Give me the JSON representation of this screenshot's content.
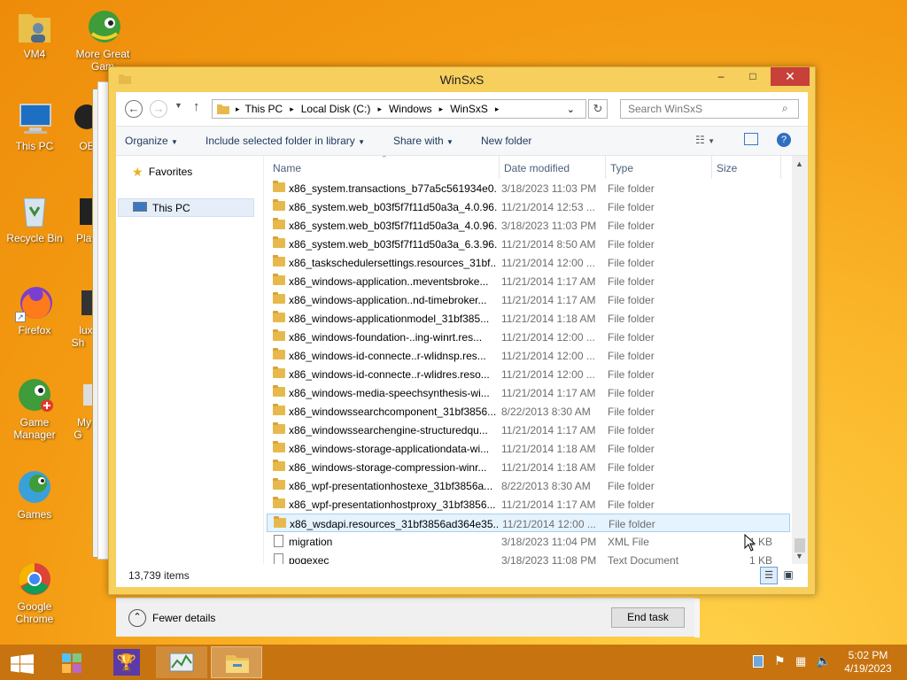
{
  "desktop": {
    "icons": [
      {
        "label": "VM4",
        "icon": "user-folder-icon"
      },
      {
        "label": "More Great Gam",
        "icon": "game-icon"
      },
      {
        "label": "This PC",
        "icon": "computer-icon"
      },
      {
        "label": "OB",
        "icon": "app-icon"
      },
      {
        "label": "Recycle Bin",
        "icon": "recycle-bin-icon"
      },
      {
        "label": "Play",
        "icon": "app-icon"
      },
      {
        "label": "Firefox",
        "icon": "firefox-icon"
      },
      {
        "label": "lux Sh",
        "icon": "app-icon"
      },
      {
        "label": "Game Manager",
        "icon": "game-manager-icon"
      },
      {
        "label": "My G",
        "icon": "app-icon"
      },
      {
        "label": "Games",
        "icon": "games-icon"
      },
      {
        "label": "Google Chrome",
        "icon": "chrome-icon"
      }
    ]
  },
  "window": {
    "title": "WinSxS",
    "controls": {
      "minimize": "–",
      "maximize": "□",
      "close": "✕"
    }
  },
  "address": {
    "path": [
      "This PC",
      "Local Disk (C:)",
      "Windows",
      "WinSxS"
    ],
    "search_placeholder": "Search WinSxS"
  },
  "toolbar": {
    "organize": "Organize",
    "include": "Include selected folder in library",
    "share": "Share with",
    "new_folder": "New folder"
  },
  "nav": {
    "favorites": "Favorites",
    "this_pc": "This PC"
  },
  "columns": {
    "name": "Name",
    "date": "Date modified",
    "type": "Type",
    "size": "Size"
  },
  "files": [
    {
      "name": "x86_system.transactions_b77a5c561934e0...",
      "date": "3/18/2023 11:03 PM",
      "type": "File folder",
      "size": "",
      "kind": "folder"
    },
    {
      "name": "x86_system.web_b03f5f7f11d50a3a_4.0.96...",
      "date": "11/21/2014 12:53 ...",
      "type": "File folder",
      "size": "",
      "kind": "folder"
    },
    {
      "name": "x86_system.web_b03f5f7f11d50a3a_4.0.96...",
      "date": "3/18/2023 11:03 PM",
      "type": "File folder",
      "size": "",
      "kind": "folder"
    },
    {
      "name": "x86_system.web_b03f5f7f11d50a3a_6.3.96...",
      "date": "11/21/2014 8:50 AM",
      "type": "File folder",
      "size": "",
      "kind": "folder"
    },
    {
      "name": "x86_taskschedulersettings.resources_31bf...",
      "date": "11/21/2014 12:00 ...",
      "type": "File folder",
      "size": "",
      "kind": "folder"
    },
    {
      "name": "x86_windows-application..meventsbroke...",
      "date": "11/21/2014 1:17 AM",
      "type": "File folder",
      "size": "",
      "kind": "folder"
    },
    {
      "name": "x86_windows-application..nd-timebroker...",
      "date": "11/21/2014 1:17 AM",
      "type": "File folder",
      "size": "",
      "kind": "folder"
    },
    {
      "name": "x86_windows-applicationmodel_31bf385...",
      "date": "11/21/2014 1:18 AM",
      "type": "File folder",
      "size": "",
      "kind": "folder"
    },
    {
      "name": "x86_windows-foundation-..ing-winrt.res...",
      "date": "11/21/2014 12:00 ...",
      "type": "File folder",
      "size": "",
      "kind": "folder"
    },
    {
      "name": "x86_windows-id-connecte..r-wlidnsp.res...",
      "date": "11/21/2014 12:00 ...",
      "type": "File folder",
      "size": "",
      "kind": "folder"
    },
    {
      "name": "x86_windows-id-connecte..r-wlidres.reso...",
      "date": "11/21/2014 12:00 ...",
      "type": "File folder",
      "size": "",
      "kind": "folder"
    },
    {
      "name": "x86_windows-media-speechsynthesis-wi...",
      "date": "11/21/2014 1:17 AM",
      "type": "File folder",
      "size": "",
      "kind": "folder"
    },
    {
      "name": "x86_windowssearchcomponent_31bf3856...",
      "date": "8/22/2013 8:30 AM",
      "type": "File folder",
      "size": "",
      "kind": "folder"
    },
    {
      "name": "x86_windowssearchengine-structuredqu...",
      "date": "11/21/2014 1:17 AM",
      "type": "File folder",
      "size": "",
      "kind": "folder"
    },
    {
      "name": "x86_windows-storage-applicationdata-wi...",
      "date": "11/21/2014 1:18 AM",
      "type": "File folder",
      "size": "",
      "kind": "folder"
    },
    {
      "name": "x86_windows-storage-compression-winr...",
      "date": "11/21/2014 1:18 AM",
      "type": "File folder",
      "size": "",
      "kind": "folder"
    },
    {
      "name": "x86_wpf-presentationhostexe_31bf3856a...",
      "date": "8/22/2013 8:30 AM",
      "type": "File folder",
      "size": "",
      "kind": "folder"
    },
    {
      "name": "x86_wpf-presentationhostproxy_31bf3856...",
      "date": "11/21/2014 1:17 AM",
      "type": "File folder",
      "size": "",
      "kind": "folder"
    },
    {
      "name": "x86_wsdapi.resources_31bf3856ad364e35...",
      "date": "11/21/2014 12:00 ...",
      "type": "File folder",
      "size": "",
      "kind": "folder",
      "selected": true
    },
    {
      "name": "migration",
      "date": "3/18/2023 11:04 PM",
      "type": "XML File",
      "size": "1 KB",
      "kind": "file"
    },
    {
      "name": "poqexec",
      "date": "3/18/2023 11:08 PM",
      "type": "Text Document",
      "size": "1 KB",
      "kind": "file"
    }
  ],
  "status": {
    "count": "13,739 items"
  },
  "task_manager": {
    "fewer_details": "Fewer details",
    "end_task": "End task"
  },
  "taskbar": {
    "time": "5:02 PM",
    "date": "4/19/2023",
    "items": [
      "start-icon",
      "game-puzzle-icon",
      "trophy-icon",
      "task-manager-icon",
      "file-explorer-icon"
    ]
  },
  "colors": {
    "accent": "#f7cf5d",
    "close": "#c7403a",
    "taskbar": "#c7730f",
    "selection": "#e5f3ff"
  }
}
